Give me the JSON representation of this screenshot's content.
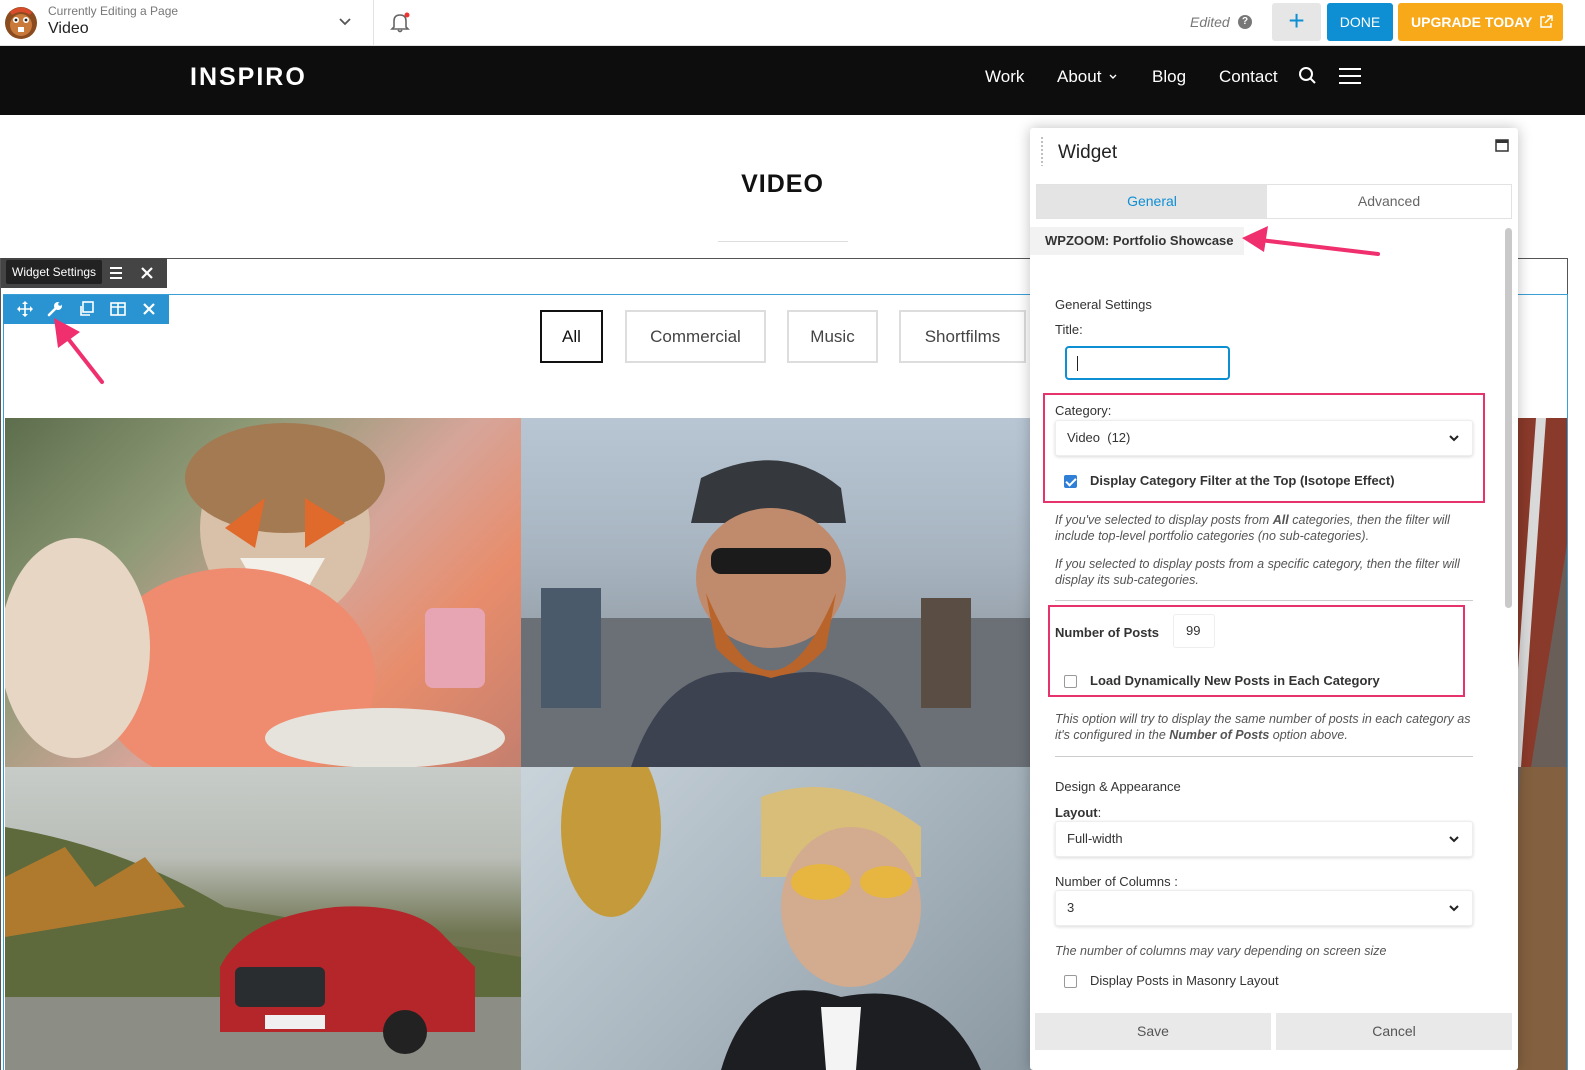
{
  "topbar": {
    "editing_label": "Currently Editing a Page",
    "page_name": "Video",
    "status": "Edited",
    "help": "?",
    "add_symbol": "+",
    "done_label": "DONE",
    "upgrade_label": "UPGRADE TODAY",
    "colors": {
      "accent": "#0e8fd4",
      "upgrade": "#f7a91a"
    }
  },
  "site": {
    "logo": "INSPIRO",
    "nav": [
      "Work",
      "About",
      "Blog",
      "Contact"
    ],
    "page_title": "VIDEO"
  },
  "builder": {
    "row_tooltip": "Widget Settings"
  },
  "filters": [
    "All",
    "Commercial",
    "Music",
    "Shortfilms"
  ],
  "panel": {
    "title": "Widget",
    "tabs": [
      "General",
      "Advanced"
    ],
    "widget_name": "WPZOOM: Portfolio Showcase",
    "general_settings": "General Settings",
    "title_label": "Title:",
    "title_value": "",
    "category_label": "Category:",
    "category_value": "Video  (12)",
    "filter_checkbox": "Display Category Filter at the Top (Isotope Effect)",
    "filter_checked": true,
    "note1_a": "If you've selected to display posts from ",
    "note1_b": "All",
    "note1_c": " categories, then the filter will include top-level portfolio categories (no sub-categories).",
    "note2": "If you selected to display posts from a specific category, then the filter will display its sub-categories.",
    "posts_label": "Number of Posts",
    "posts_value": "99",
    "dynamic_checkbox": "Load Dynamically New Posts in Each Category",
    "dynamic_checked": false,
    "note3_a": "This option will try to display the same number of posts in each category as it's configured in the ",
    "note3_b": "Number of Posts",
    "note3_c": " option above.",
    "design_label": "Design & Appearance",
    "layout_label": "Layout",
    "layout_colon": ":",
    "layout_value": "Full-width",
    "columns_label": "Number of Columns :",
    "columns_value": "3",
    "columns_note": "The number of columns may vary depending on screen size",
    "masonry_checkbox": "Display Posts in Masonry Layout",
    "masonry_checked": false,
    "save_label": "Save",
    "cancel_label": "Cancel"
  },
  "highlight_color": "#e6336b"
}
